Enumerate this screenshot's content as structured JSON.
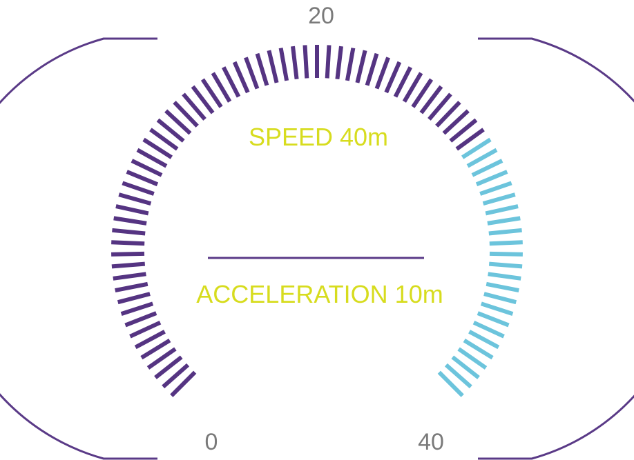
{
  "gauge": {
    "min_label": "0",
    "mid_label": "20",
    "max_label": "40",
    "min": 0,
    "max": 40,
    "highlight_from_fraction": 0.7,
    "tick_count": 81,
    "speed_text": "SPEED 40m",
    "acceleration_text": "ACCELERATION 10m",
    "colors": {
      "frame": "#5a3a87",
      "tick_primary": "#553482",
      "tick_highlight": "#6cc4dc",
      "readout": "#d7dc1e",
      "scale_label": "#7a7a7a"
    }
  }
}
